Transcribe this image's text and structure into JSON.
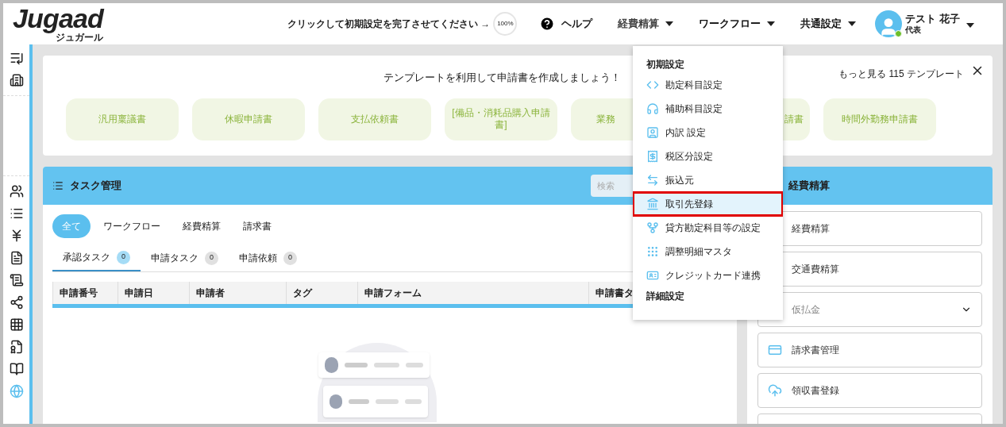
{
  "header": {
    "logo": "Jugaad",
    "logo_sub": "ジュガール",
    "setup_prompt": "クリックして初期設定を完了させてください →",
    "progress": "100%",
    "help": "ヘルプ",
    "nav": [
      {
        "label": "経費精算",
        "expanded": true
      },
      {
        "label": "ワークフロー",
        "expanded": false
      },
      {
        "label": "共通設定",
        "expanded": false
      }
    ],
    "user": {
      "name": "テスト 花子",
      "role": "代表",
      "online": true
    }
  },
  "templates": {
    "title": "テンプレートを利用して申請書を作成しましょう！",
    "more": "もっと見る 115 テンプレート",
    "items": [
      "汎用稟議書",
      "休暇申請書",
      "支払依頼書",
      "[備品・消耗品購入申請書]",
      "業務",
      "請書",
      "時間外勤務申請書"
    ]
  },
  "tasks": {
    "title": "タスク管理",
    "search": {
      "placeholder": "検索"
    },
    "filters": [
      {
        "label": "全て",
        "selected": true
      },
      {
        "label": "ワークフロー",
        "selected": false
      },
      {
        "label": "経費精算",
        "selected": false
      },
      {
        "label": "請求書",
        "selected": false
      }
    ],
    "subtabs": [
      {
        "label": "承認タスク",
        "count": "0",
        "selected": true
      },
      {
        "label": "申請タスク",
        "count": "0",
        "selected": false
      },
      {
        "label": "申請依頼",
        "count": "0",
        "selected": false
      }
    ],
    "columns": [
      "申請番号",
      "申請日",
      "申請者",
      "タグ",
      "申請フォーム",
      "申請書タ"
    ]
  },
  "expense_panel": {
    "title": "経費精算",
    "items": [
      {
        "label": "経費精算",
        "kind": "link"
      },
      {
        "label": "交通費精算",
        "kind": "link"
      },
      {
        "label": "仮払金",
        "kind": "dropdown"
      },
      {
        "label": "請求書管理",
        "kind": "link"
      },
      {
        "label": "領収書登録",
        "kind": "link"
      }
    ]
  },
  "menu": {
    "sections": [
      {
        "heading": "初期設定",
        "items": [
          {
            "label": "勘定科目設定",
            "selected": false
          },
          {
            "label": "補助科目設定",
            "selected": false
          },
          {
            "label": "内訳 設定",
            "selected": false
          },
          {
            "label": "税区分設定",
            "selected": false
          },
          {
            "label": "振込元",
            "selected": false
          },
          {
            "label": "取引先登録",
            "selected": true
          },
          {
            "label": "貸方勘定科目等の設定",
            "selected": false
          },
          {
            "label": "調整明細マスタ",
            "selected": false
          },
          {
            "label": "クレジットカード連携",
            "selected": false
          }
        ]
      },
      {
        "heading": "詳細設定"
      }
    ]
  }
}
